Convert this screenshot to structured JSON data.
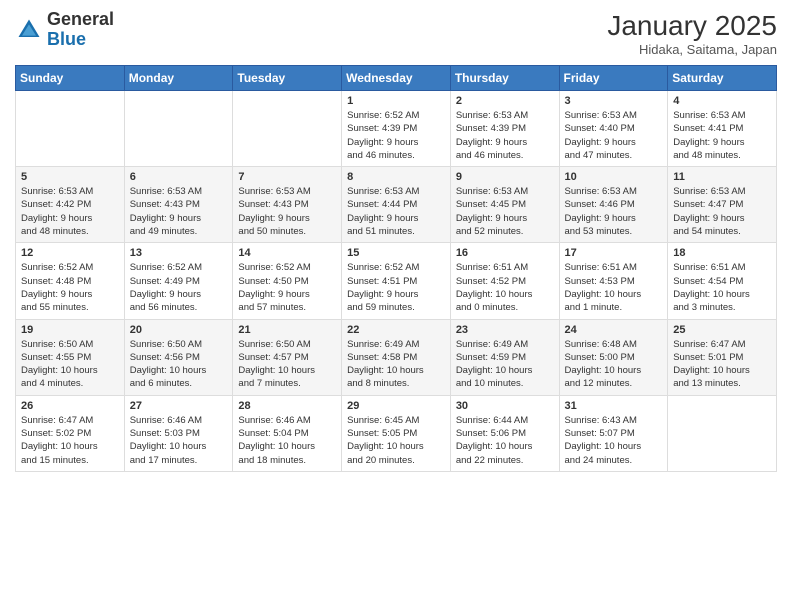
{
  "header": {
    "logo_general": "General",
    "logo_blue": "Blue",
    "month_title": "January 2025",
    "location": "Hidaka, Saitama, Japan"
  },
  "weekdays": [
    "Sunday",
    "Monday",
    "Tuesday",
    "Wednesday",
    "Thursday",
    "Friday",
    "Saturday"
  ],
  "weeks": [
    [
      {
        "day": "",
        "info": ""
      },
      {
        "day": "",
        "info": ""
      },
      {
        "day": "",
        "info": ""
      },
      {
        "day": "1",
        "info": "Sunrise: 6:52 AM\nSunset: 4:39 PM\nDaylight: 9 hours\nand 46 minutes."
      },
      {
        "day": "2",
        "info": "Sunrise: 6:53 AM\nSunset: 4:39 PM\nDaylight: 9 hours\nand 46 minutes."
      },
      {
        "day": "3",
        "info": "Sunrise: 6:53 AM\nSunset: 4:40 PM\nDaylight: 9 hours\nand 47 minutes."
      },
      {
        "day": "4",
        "info": "Sunrise: 6:53 AM\nSunset: 4:41 PM\nDaylight: 9 hours\nand 48 minutes."
      }
    ],
    [
      {
        "day": "5",
        "info": "Sunrise: 6:53 AM\nSunset: 4:42 PM\nDaylight: 9 hours\nand 48 minutes."
      },
      {
        "day": "6",
        "info": "Sunrise: 6:53 AM\nSunset: 4:43 PM\nDaylight: 9 hours\nand 49 minutes."
      },
      {
        "day": "7",
        "info": "Sunrise: 6:53 AM\nSunset: 4:43 PM\nDaylight: 9 hours\nand 50 minutes."
      },
      {
        "day": "8",
        "info": "Sunrise: 6:53 AM\nSunset: 4:44 PM\nDaylight: 9 hours\nand 51 minutes."
      },
      {
        "day": "9",
        "info": "Sunrise: 6:53 AM\nSunset: 4:45 PM\nDaylight: 9 hours\nand 52 minutes."
      },
      {
        "day": "10",
        "info": "Sunrise: 6:53 AM\nSunset: 4:46 PM\nDaylight: 9 hours\nand 53 minutes."
      },
      {
        "day": "11",
        "info": "Sunrise: 6:53 AM\nSunset: 4:47 PM\nDaylight: 9 hours\nand 54 minutes."
      }
    ],
    [
      {
        "day": "12",
        "info": "Sunrise: 6:52 AM\nSunset: 4:48 PM\nDaylight: 9 hours\nand 55 minutes."
      },
      {
        "day": "13",
        "info": "Sunrise: 6:52 AM\nSunset: 4:49 PM\nDaylight: 9 hours\nand 56 minutes."
      },
      {
        "day": "14",
        "info": "Sunrise: 6:52 AM\nSunset: 4:50 PM\nDaylight: 9 hours\nand 57 minutes."
      },
      {
        "day": "15",
        "info": "Sunrise: 6:52 AM\nSunset: 4:51 PM\nDaylight: 9 hours\nand 59 minutes."
      },
      {
        "day": "16",
        "info": "Sunrise: 6:51 AM\nSunset: 4:52 PM\nDaylight: 10 hours\nand 0 minutes."
      },
      {
        "day": "17",
        "info": "Sunrise: 6:51 AM\nSunset: 4:53 PM\nDaylight: 10 hours\nand 1 minute."
      },
      {
        "day": "18",
        "info": "Sunrise: 6:51 AM\nSunset: 4:54 PM\nDaylight: 10 hours\nand 3 minutes."
      }
    ],
    [
      {
        "day": "19",
        "info": "Sunrise: 6:50 AM\nSunset: 4:55 PM\nDaylight: 10 hours\nand 4 minutes."
      },
      {
        "day": "20",
        "info": "Sunrise: 6:50 AM\nSunset: 4:56 PM\nDaylight: 10 hours\nand 6 minutes."
      },
      {
        "day": "21",
        "info": "Sunrise: 6:50 AM\nSunset: 4:57 PM\nDaylight: 10 hours\nand 7 minutes."
      },
      {
        "day": "22",
        "info": "Sunrise: 6:49 AM\nSunset: 4:58 PM\nDaylight: 10 hours\nand 8 minutes."
      },
      {
        "day": "23",
        "info": "Sunrise: 6:49 AM\nSunset: 4:59 PM\nDaylight: 10 hours\nand 10 minutes."
      },
      {
        "day": "24",
        "info": "Sunrise: 6:48 AM\nSunset: 5:00 PM\nDaylight: 10 hours\nand 12 minutes."
      },
      {
        "day": "25",
        "info": "Sunrise: 6:47 AM\nSunset: 5:01 PM\nDaylight: 10 hours\nand 13 minutes."
      }
    ],
    [
      {
        "day": "26",
        "info": "Sunrise: 6:47 AM\nSunset: 5:02 PM\nDaylight: 10 hours\nand 15 minutes."
      },
      {
        "day": "27",
        "info": "Sunrise: 6:46 AM\nSunset: 5:03 PM\nDaylight: 10 hours\nand 17 minutes."
      },
      {
        "day": "28",
        "info": "Sunrise: 6:46 AM\nSunset: 5:04 PM\nDaylight: 10 hours\nand 18 minutes."
      },
      {
        "day": "29",
        "info": "Sunrise: 6:45 AM\nSunset: 5:05 PM\nDaylight: 10 hours\nand 20 minutes."
      },
      {
        "day": "30",
        "info": "Sunrise: 6:44 AM\nSunset: 5:06 PM\nDaylight: 10 hours\nand 22 minutes."
      },
      {
        "day": "31",
        "info": "Sunrise: 6:43 AM\nSunset: 5:07 PM\nDaylight: 10 hours\nand 24 minutes."
      },
      {
        "day": "",
        "info": ""
      }
    ]
  ]
}
